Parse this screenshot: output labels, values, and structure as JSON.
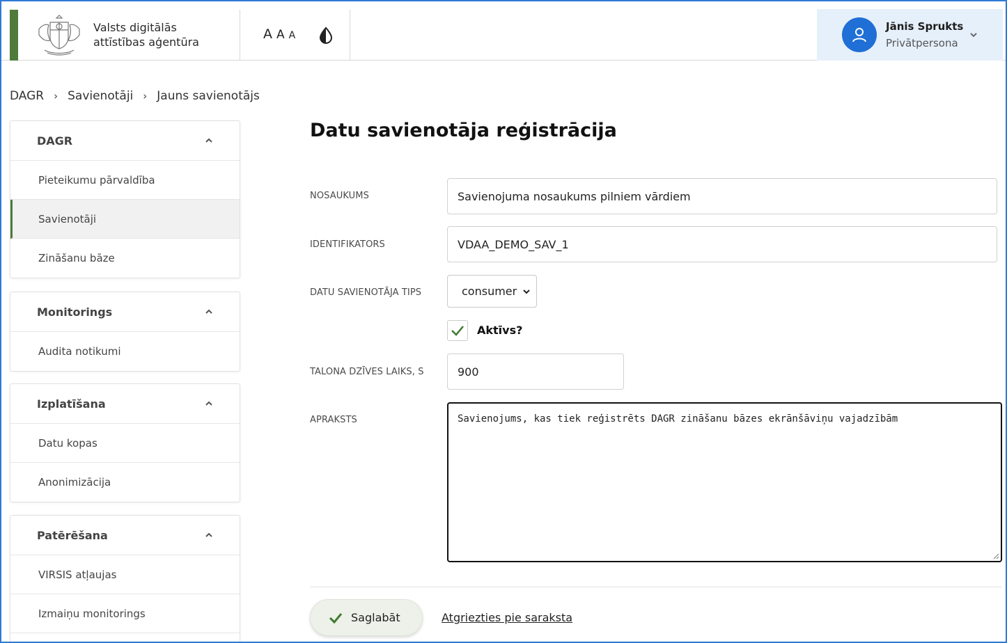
{
  "header": {
    "agency_line1": "Valsts digitālās",
    "agency_line2": "attīstības aģentūra",
    "font_sizes": [
      "A",
      "A",
      "A"
    ],
    "contrast_icon": "contrast-drop-icon",
    "user": {
      "name": "Jānis Sprukts",
      "role": "Privātpersona",
      "avatar_icon": "user-icon"
    }
  },
  "breadcrumb": [
    "DAGR",
    "Savienotāji",
    "Jauns savienotājs"
  ],
  "sidebar": {
    "groups": [
      {
        "title": "DAGR",
        "items": [
          "Pieteikumu pārvaldība",
          "Savienotāji",
          "Zināšanu bāze"
        ]
      },
      {
        "title": "Monitorings",
        "items": [
          "Audita notikumi"
        ]
      },
      {
        "title": "Izplatīšana",
        "items": [
          "Datu kopas",
          "Anonimizācija"
        ]
      },
      {
        "title": "Patērēšana",
        "items": [
          "VIRSIS atļaujas",
          "Izmaiņu monitorings"
        ]
      }
    ],
    "active_item": "Savienotāji"
  },
  "form": {
    "title": "Datu savienotāja reģistrācija",
    "name_label": "NOSAUKUMS",
    "name_value": "Savienojuma nosaukums pilniem vārdiem",
    "id_label": "IDENTIFIKATORS",
    "id_value": "VDAA_DEMO_SAV_1",
    "type_label": "DATU SAVIENOTĀJA TIPS",
    "type_value": "consumer",
    "active_label": "Aktīvs?",
    "active_checked": true,
    "ttl_label": "TALONA DZĪVES LAIKS, S",
    "ttl_value": "900",
    "desc_label": "APRAKSTS",
    "desc_value": "Savienojums, kas tiek reģistrēts DAGR zināšanu bāzes ekrānšāviņu vajadzībām",
    "save_label": "Saglabāt",
    "back_label": "Atgriezties pie saraksta"
  },
  "colors": {
    "accent_green": "#4e7a3a",
    "user_bg": "#e6f0fa",
    "avatar_blue": "#1f6fd6",
    "frame_blue": "#2f7ad6"
  }
}
